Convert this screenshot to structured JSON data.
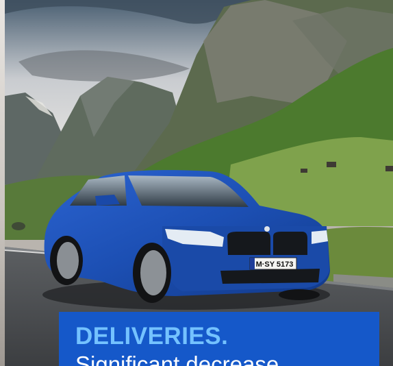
{
  "car": {
    "plate_text": "M·SY 5173"
  },
  "promo": {
    "title": "DELIVERIES.",
    "subtitle": "Significant decrease."
  },
  "colors": {
    "promo_background": "#1558c9",
    "promo_title": "#74c2ff",
    "promo_subtitle": "#ffffff",
    "car_body": "#1c4fb3"
  }
}
